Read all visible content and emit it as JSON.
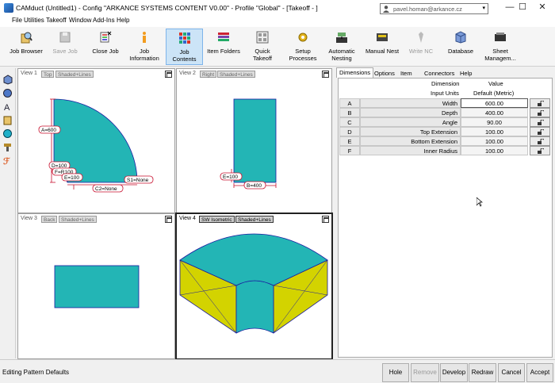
{
  "window": {
    "title": "CAMduct (Untitled1) - Config \"ARKANCE SYSTEMS CONTENT V0.00\" - Profile \"Global\" - [Takeoff - ]",
    "user": "pavel.homan@arkance.cz",
    "minimize": "—",
    "maximize": "☐",
    "close": "✕"
  },
  "menu": [
    "File",
    "Utilities",
    "Takeoff",
    "Window",
    "Add-Ins",
    "Help"
  ],
  "toolbar": [
    {
      "label": "Job Browser",
      "icon": "job-browser-icon"
    },
    {
      "label": "Save Job",
      "icon": "save-job-icon",
      "disabled": true
    },
    {
      "label": "Close Job",
      "icon": "close-job-icon"
    },
    {
      "label": "Job\nInformation",
      "icon": "job-information-icon"
    },
    {
      "label": "Job\nContents",
      "icon": "job-contents-icon",
      "selected": true
    },
    {
      "label": "Item Folders",
      "icon": "item-folders-icon"
    },
    {
      "label": "Quick\nTakeoff",
      "icon": "quick-takeoff-icon"
    },
    {
      "label": "Setup\nProcesses",
      "icon": "setup-processes-icon"
    },
    {
      "label": "Automatic\nNesting",
      "icon": "automatic-nesting-icon"
    },
    {
      "label": "Manual Nest",
      "icon": "manual-nest-icon"
    },
    {
      "label": "Write NC",
      "icon": "write-nc-icon",
      "disabled": true
    },
    {
      "label": "Database",
      "icon": "database-icon"
    },
    {
      "label": "Sheet\nManagem...",
      "icon": "sheet-management-icon"
    }
  ],
  "views": {
    "v1": {
      "label": "View 1",
      "tags": [
        "Top",
        "Shaded+Lines"
      ],
      "dims": {
        "a": "A=600",
        "d": "D=100",
        "f": "F=R100",
        "e": "E=100",
        "c2": "C2=None",
        "s1": "S1=None"
      }
    },
    "v2": {
      "label": "View 2",
      "tags": [
        "Right",
        "Shaded+Lines"
      ],
      "dims": {
        "e": "E=100",
        "b": "B=400"
      }
    },
    "v3": {
      "label": "View 3",
      "tags": [
        "Back",
        "Shaded+Lines"
      ]
    },
    "v4": {
      "label": "View 4",
      "tags": [
        "SW Isometric",
        "Shaded+Lines"
      ]
    }
  },
  "panel": {
    "tabs": [
      "Dimensions",
      "Options",
      "Item",
      "Connectors",
      "Help"
    ],
    "header": {
      "dimension": "Dimension",
      "value": "Value",
      "input_units": "Input Units",
      "units_value": "Default (Metric)"
    },
    "rows": [
      {
        "id": "A",
        "name": "Width",
        "value": "600.00"
      },
      {
        "id": "B",
        "name": "Depth",
        "value": "400.00"
      },
      {
        "id": "C",
        "name": "Angle",
        "value": "90.00"
      },
      {
        "id": "D",
        "name": "Top Extension",
        "value": "100.00"
      },
      {
        "id": "E",
        "name": "Bottom Extension",
        "value": "100.00"
      },
      {
        "id": "F",
        "name": "Inner Radius",
        "value": "100.00"
      }
    ]
  },
  "status": {
    "text": "Editing Pattern Defaults",
    "buttons": [
      {
        "label": "Hole"
      },
      {
        "label": "Remove",
        "disabled": true
      },
      {
        "label": "Develop"
      },
      {
        "label": "Redraw"
      },
      {
        "label": "Cancel"
      },
      {
        "label": "Accept"
      }
    ]
  },
  "colors": {
    "accent": "#0078d7",
    "shape_fill": "#23b5b5",
    "side_fill": "#d3d300",
    "dim_line": "#c8102e",
    "edge": "#1a1aa0"
  }
}
